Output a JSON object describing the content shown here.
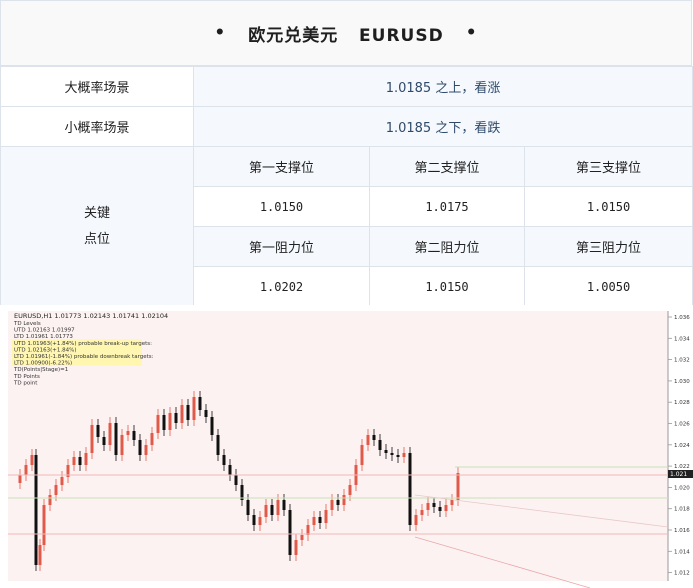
{
  "title": {
    "bullet_left": "•",
    "text": "欧元兑美元   EURUSD",
    "bullet_right": "•"
  },
  "scenarios": [
    {
      "label": "大概率场景",
      "value": "1.0185 之上，看涨"
    },
    {
      "label": "小概率场景",
      "value": "1.0185 之下，看跌"
    }
  ],
  "key_levels": {
    "label_line1": "关键",
    "label_line2": "点位",
    "support_headers": [
      "第一支撑位",
      "第二支撑位",
      "第三支撑位"
    ],
    "support_values": [
      "1.0150",
      "1.0175",
      "1.0150"
    ],
    "resistance_headers": [
      "第一阻力位",
      "第二阻力位",
      "第三阻力位"
    ],
    "resistance_values": [
      "1.0202",
      "1.0150",
      "1.0050"
    ]
  },
  "chart": {
    "header": "EURUSD,H1  1.01773 1.02143 1.01741 1.02104",
    "annotations": [
      "TD Levels",
      "UTD 1.02163  1.01997",
      "LTD 1.01961  1.01773",
      "UTD 1.01963(+1.84%) probable break-up targets:",
      "UTD 1.02163(+1.84%)",
      "LTD 1.01961(-1.84%) probable downbreak targets:",
      "LTD 1.00900(-6.22%)",
      "TD(Points|Stage)=1",
      "TD Points",
      "TD point"
    ],
    "price_ticks": [
      "1.036",
      "1.034",
      "1.032",
      "1.030",
      "1.028",
      "1.026",
      "1.024",
      "1.022",
      "1.020",
      "1.018",
      "1.016",
      "1.014",
      "1.012"
    ],
    "current_price": "1.021",
    "colors": {
      "up": "#e05a4a",
      "down": "#111111",
      "bg": "#fdf2f2",
      "support_line": "#c8e3b8",
      "resistance_line": "#f2b8b8"
    }
  }
}
